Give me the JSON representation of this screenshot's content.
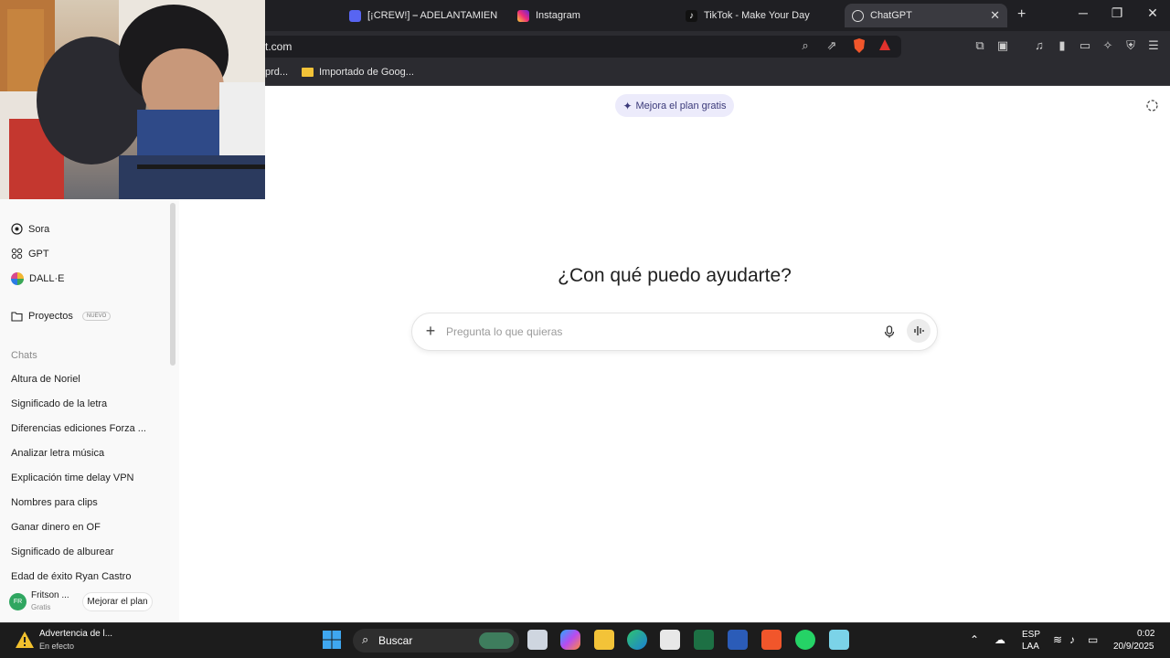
{
  "browser": {
    "tabs": [
      {
        "label": "[¡CREW!] ⎯ ADELANTAMIENTO",
        "icon": "discord-icon",
        "color": "#5865f2"
      },
      {
        "label": "Instagram",
        "icon": "instagram-icon",
        "color": "#e1306c"
      },
      {
        "label": "TikTok - Make Your Day",
        "icon": "tiktok-icon",
        "color": "#000000"
      },
      {
        "label": "ChatGPT",
        "icon": "chatgpt-icon",
        "color": "#ffffff",
        "active": true
      }
    ],
    "url": "t.com",
    "bookmarks": [
      "prd...",
      "Importado de Goog..."
    ]
  },
  "upgrade_pill": "Mejora el plan gratis",
  "sidebar": {
    "items": [
      {
        "label": "Sora",
        "icon": "sora-icon"
      },
      {
        "label": "GPT",
        "icon": "gpt-grid-icon"
      },
      {
        "label": "DALL·E",
        "icon": "dalle-icon"
      }
    ],
    "projects": {
      "label": "Proyectos",
      "badge": "NUEVO"
    },
    "chats_header": "Chats",
    "chats": [
      "Altura de Noriel",
      "Significado de la letra",
      "Diferencias ediciones Forza ...",
      "Analizar letra música",
      "Explicación time delay VPN",
      "Nombres para clips",
      "Ganar dinero en OF",
      "Significado de alburear",
      "Edad de éxito Ryan Castro"
    ],
    "user": {
      "initials": "FR",
      "name": "Fritson ...",
      "plan": "Gratis"
    },
    "upgrade_button": "Mejorar el plan"
  },
  "main": {
    "heading": "¿Con qué puedo ayudarte?",
    "input_placeholder": "Pregunta lo que quieras"
  },
  "taskbar": {
    "alert_title": "Advertencia de l...",
    "alert_sub": "En efecto",
    "search": "Buscar",
    "lang_top": "ESP",
    "lang_bottom": "LAA",
    "time": "0:02",
    "date": "20/9/2025"
  }
}
